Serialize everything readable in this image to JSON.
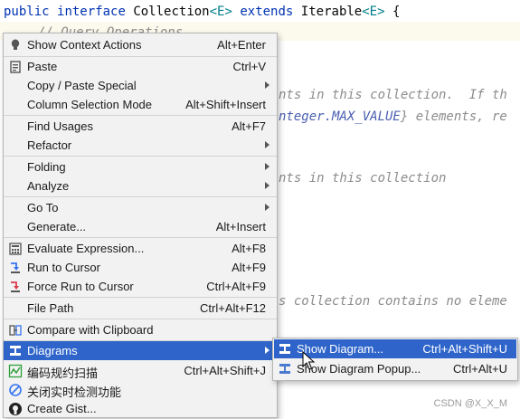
{
  "editor": {
    "line1": {
      "kw1": "public",
      "kw2": "interface",
      "name": "Collection",
      "gen1": "<E>",
      "kw3": "extends",
      "name2": "Iterable",
      "gen2": "<E>",
      "brace": "{"
    },
    "comment_query": "// Query Operations",
    "comment_frag1": "nts in this collection.  If th",
    "comment_frag2_pre": "nteger.MAX_VALUE",
    "comment_frag2_post": "} elements, re",
    "comment_frag3": "nts in this collection",
    "comment_frag4": "s collection contains no eleme"
  },
  "watermark": "CSDN @X_X_M",
  "menu": {
    "items": [
      {
        "label": "Show Context Actions",
        "shortcut": "Alt+Enter",
        "icon": "bulb-icon"
      },
      {
        "label": "Paste",
        "shortcut": "Ctrl+V",
        "icon": "paste-icon"
      },
      {
        "label": "Copy / Paste Special",
        "shortcut": "",
        "icon": ""
      },
      {
        "label": "Column Selection Mode",
        "shortcut": "Alt+Shift+Insert",
        "icon": ""
      },
      {
        "label": "Find Usages",
        "shortcut": "Alt+F7",
        "icon": ""
      },
      {
        "label": "Refactor",
        "shortcut": "",
        "icon": ""
      },
      {
        "label": "Folding",
        "shortcut": "",
        "icon": ""
      },
      {
        "label": "Analyze",
        "shortcut": "",
        "icon": ""
      },
      {
        "label": "Go To",
        "shortcut": "",
        "icon": ""
      },
      {
        "label": "Generate...",
        "shortcut": "Alt+Insert",
        "icon": ""
      },
      {
        "label": "Evaluate Expression...",
        "shortcut": "Alt+F8",
        "icon": "calculator-icon"
      },
      {
        "label": "Run to Cursor",
        "shortcut": "Alt+F9",
        "icon": "run-to-cursor-icon"
      },
      {
        "label": "Force Run to Cursor",
        "shortcut": "Ctrl+Alt+F9",
        "icon": "force-run-to-cursor-icon"
      },
      {
        "label": "File Path",
        "shortcut": "Ctrl+Alt+F12",
        "icon": ""
      },
      {
        "label": "Compare with Clipboard",
        "shortcut": "",
        "icon": "compare-icon"
      },
      {
        "label": "Diagrams",
        "shortcut": "",
        "icon": "diagram-icon"
      },
      {
        "label": "编码规约扫描",
        "shortcut": "Ctrl+Alt+Shift+J",
        "icon": "scan-icon"
      },
      {
        "label": "关闭实时检测功能",
        "shortcut": "",
        "icon": "disable-icon"
      },
      {
        "label": "Create Gist...",
        "shortcut": "",
        "icon": "github-icon"
      }
    ]
  },
  "submenu": {
    "items": [
      {
        "label": "Show Diagram...",
        "shortcut": "Ctrl+Alt+Shift+U",
        "icon": "diagram-icon"
      },
      {
        "label": "Show Diagram Popup...",
        "shortcut": "Ctrl+Alt+U",
        "icon": "diagram-popup-icon"
      }
    ]
  },
  "colors": {
    "selection": "#2f65ca",
    "menu_bg": "#f2f2f2",
    "keyword": "#0033b3",
    "generic": "#007e8a",
    "comment": "#8c8c8c"
  }
}
